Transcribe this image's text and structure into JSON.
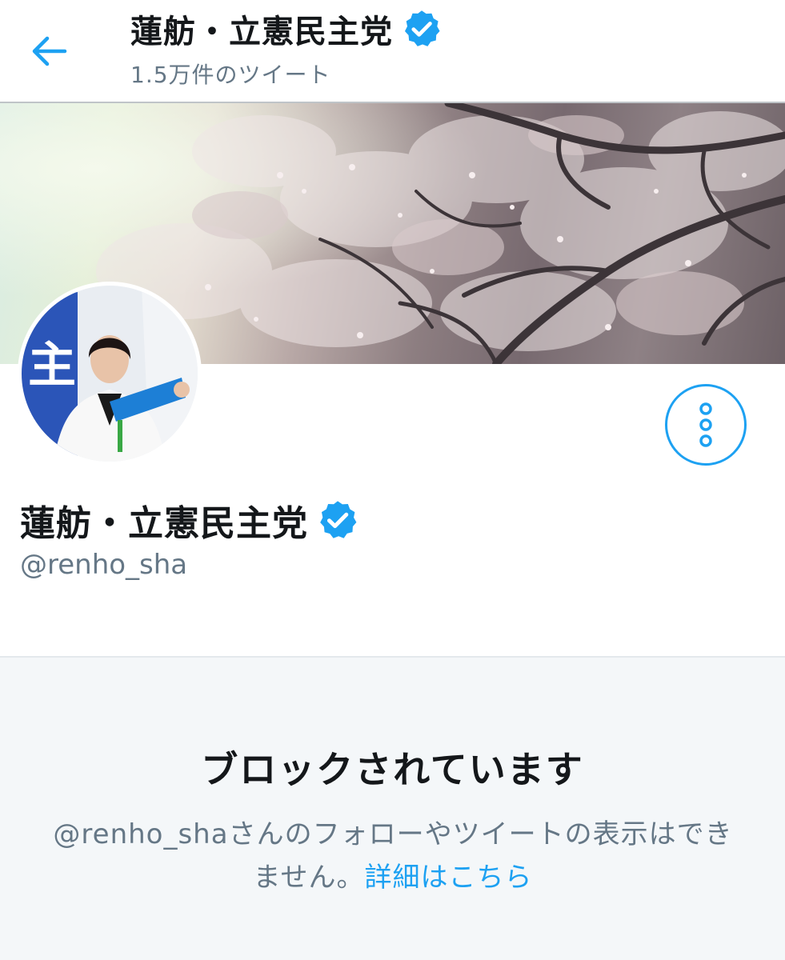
{
  "header": {
    "back_icon": "arrow-left-icon",
    "title": "蓮舫・立憲民主党",
    "verified_icon": "verified-badge-icon",
    "tweet_count": "1.5万件のツイート"
  },
  "banner": {
    "image": "cherry-blossom-banner"
  },
  "profile": {
    "avatar": "profile-photo",
    "more_icon": "vertical-ellipsis-icon",
    "display_name": "蓮舫・立憲民主党",
    "verified_icon": "verified-badge-icon",
    "handle": "@renho_sha"
  },
  "blocked": {
    "title": "ブロックされています",
    "description": "@renho_shaさんのフォローやツイートの表示はできません。",
    "learn_more": "詳細はこちら"
  },
  "colors": {
    "accent": "#1da1f2",
    "text_primary": "#14171a",
    "text_secondary": "#657786",
    "blocked_bg": "#f4f7f9"
  }
}
